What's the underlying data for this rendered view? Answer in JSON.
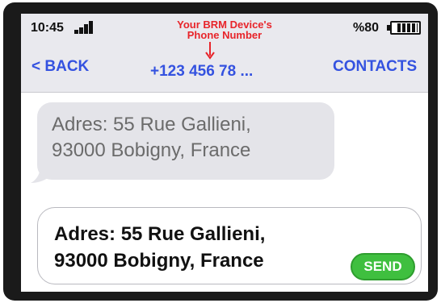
{
  "status_bar": {
    "time": "10:45",
    "battery": "%80",
    "signal_icon": "signal-bars-icon",
    "battery_icon": "battery-icon"
  },
  "annotation": {
    "line1": "Your BRM Device's",
    "line2": "Phone Number",
    "color": "#e8242a"
  },
  "nav": {
    "back_label": "< BACK",
    "phone_number": "+123 456 78 ...",
    "contacts_label": "CONTACTS",
    "accent_color": "#3452e0"
  },
  "messages": {
    "received_line1": "Adres: 55 Rue Gallieni,",
    "received_line2": "93000 Bobigny, France"
  },
  "compose": {
    "line1": "Adres: 55 Rue Gallieni,",
    "line2": "93000 Bobigny, France",
    "send_label": "SEND",
    "send_color": "#3fbf3f"
  }
}
